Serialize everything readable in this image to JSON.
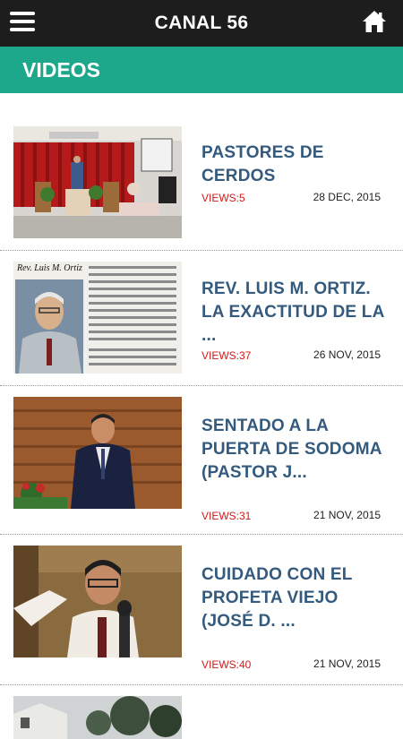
{
  "app": {
    "title": "CANAL 56",
    "menu_icon": "hamburger-menu-icon",
    "home_icon": "home-icon"
  },
  "section": {
    "title": "VIDEOS",
    "color": "#1ea88b"
  },
  "videos": [
    {
      "title": "PASTORES DE CERDOS",
      "views": "VIEWS:5",
      "date": "28 DEC, 2015",
      "thumb_icon": "church-pulpit-thumbnail"
    },
    {
      "title": "REV. LUIS M. ORTIZ. LA EXACTITUD DE LA ...",
      "views": "VIEWS:37",
      "date": "26 NOV, 2015",
      "thumb_icon": "portrait-with-text-thumbnail",
      "thumb_caption": "Rev. Luis M. Ortiz"
    },
    {
      "title": "SENTADO A LA PUERTA DE SODOMA (PASTOR J...",
      "views": "VIEWS:31",
      "date": "21 NOV, 2015",
      "thumb_icon": "preacher-thumbnail"
    },
    {
      "title": "CUIDADO CON EL PROFETA VIEJO (JOSÉ D. ...",
      "views": "VIEWS:40",
      "date": "21 NOV, 2015",
      "thumb_icon": "preacher-microphone-thumbnail"
    }
  ]
}
